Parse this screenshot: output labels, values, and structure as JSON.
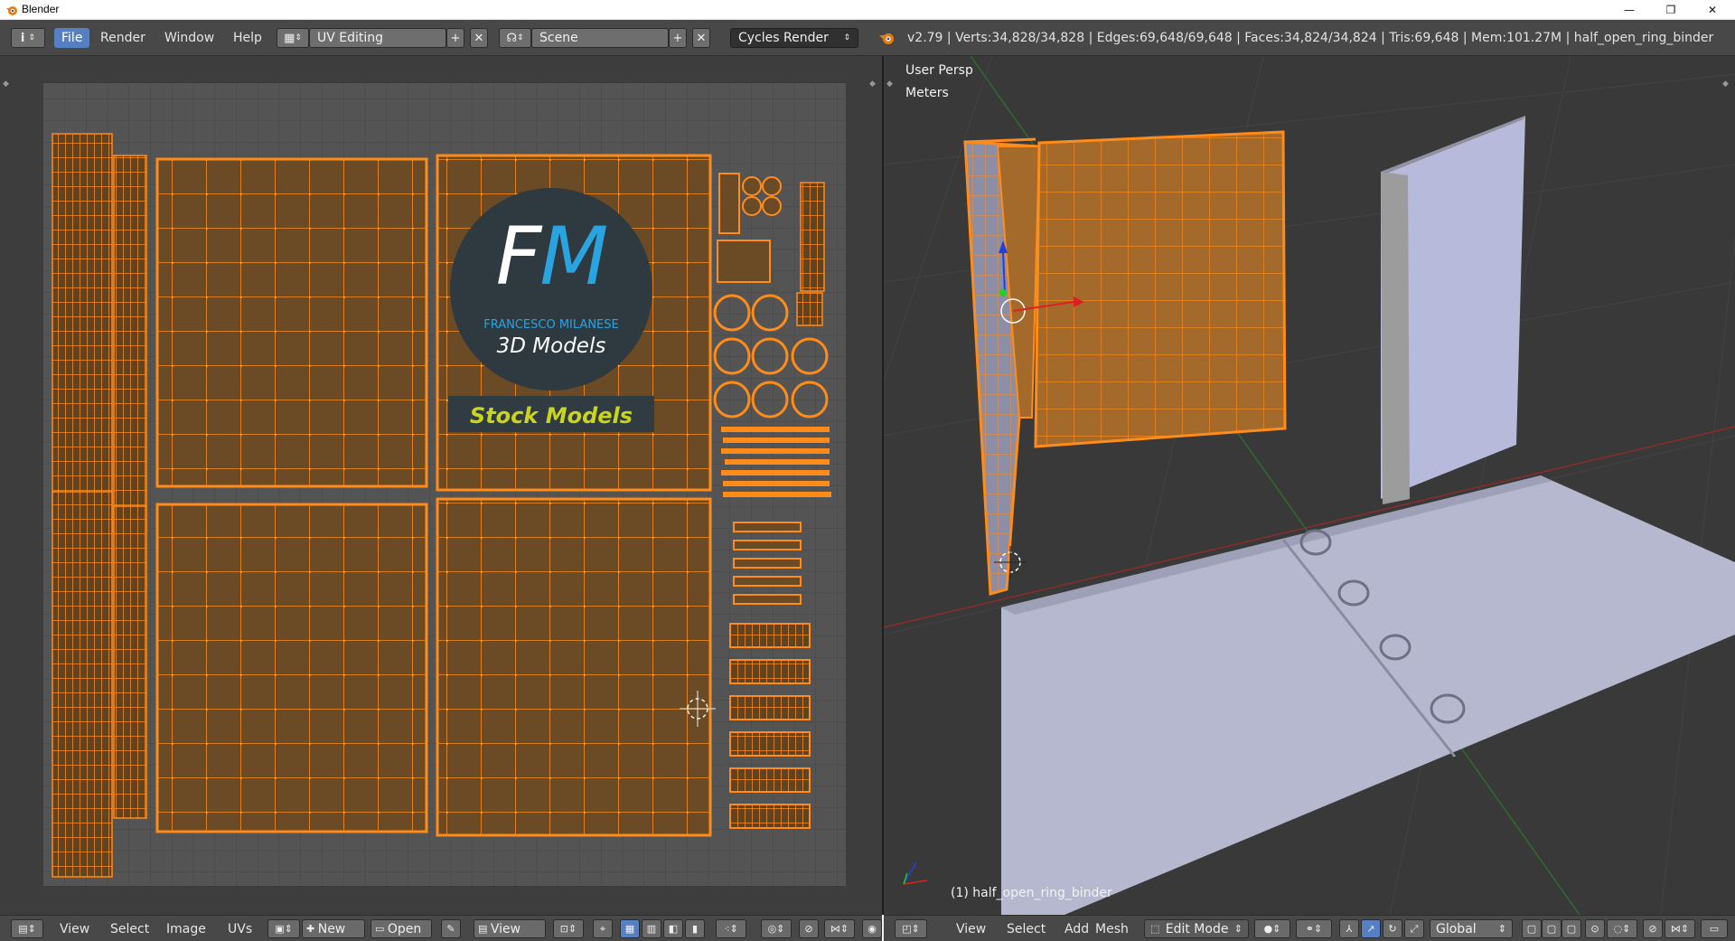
{
  "window": {
    "title": "Blender",
    "controls": {
      "minimize": "—",
      "maximize": "❐",
      "close": "✕"
    }
  },
  "topbar": {
    "info_icon": "i",
    "menus": [
      "File",
      "Render",
      "Window",
      "Help"
    ],
    "layout_name": "UV Editing",
    "scene_name": "Scene",
    "render_engine": "Cycles Render",
    "add_glyph": "+",
    "remove_glyph": "✕",
    "stats": "v2.79 | Verts:34,828/34,828 | Edges:69,648/69,648 | Faces:34,824/34,824 | Tris:69,648 | Mem:101.27M | half_open_ring_binder"
  },
  "uv_editor": {
    "texture": {
      "logo_letters_left": "F",
      "logo_letters_right": "M",
      "brand": "FRANCESCO MILANESE",
      "subtitle": "3D Models",
      "banner": "Stock Models"
    },
    "header": {
      "menus": [
        "View",
        "Select",
        "Image",
        "UVs"
      ],
      "new_label": "New",
      "open_label": "Open",
      "view_label": "View"
    }
  },
  "viewport": {
    "view_name": "User Persp",
    "units": "Meters",
    "object_label": "(1) half_open_ring_binder",
    "header": {
      "menus": [
        "View",
        "Select",
        "Add",
        "Mesh"
      ],
      "mode": "Edit Mode",
      "orientation": "Global"
    }
  },
  "colors": {
    "accent_blue": "#5680c2",
    "wire_orange": "#ff8c1a",
    "logo_blue": "#2aa4e0",
    "banner_yellow": "#c8d420",
    "binder_surface": "#b6b8d0"
  }
}
